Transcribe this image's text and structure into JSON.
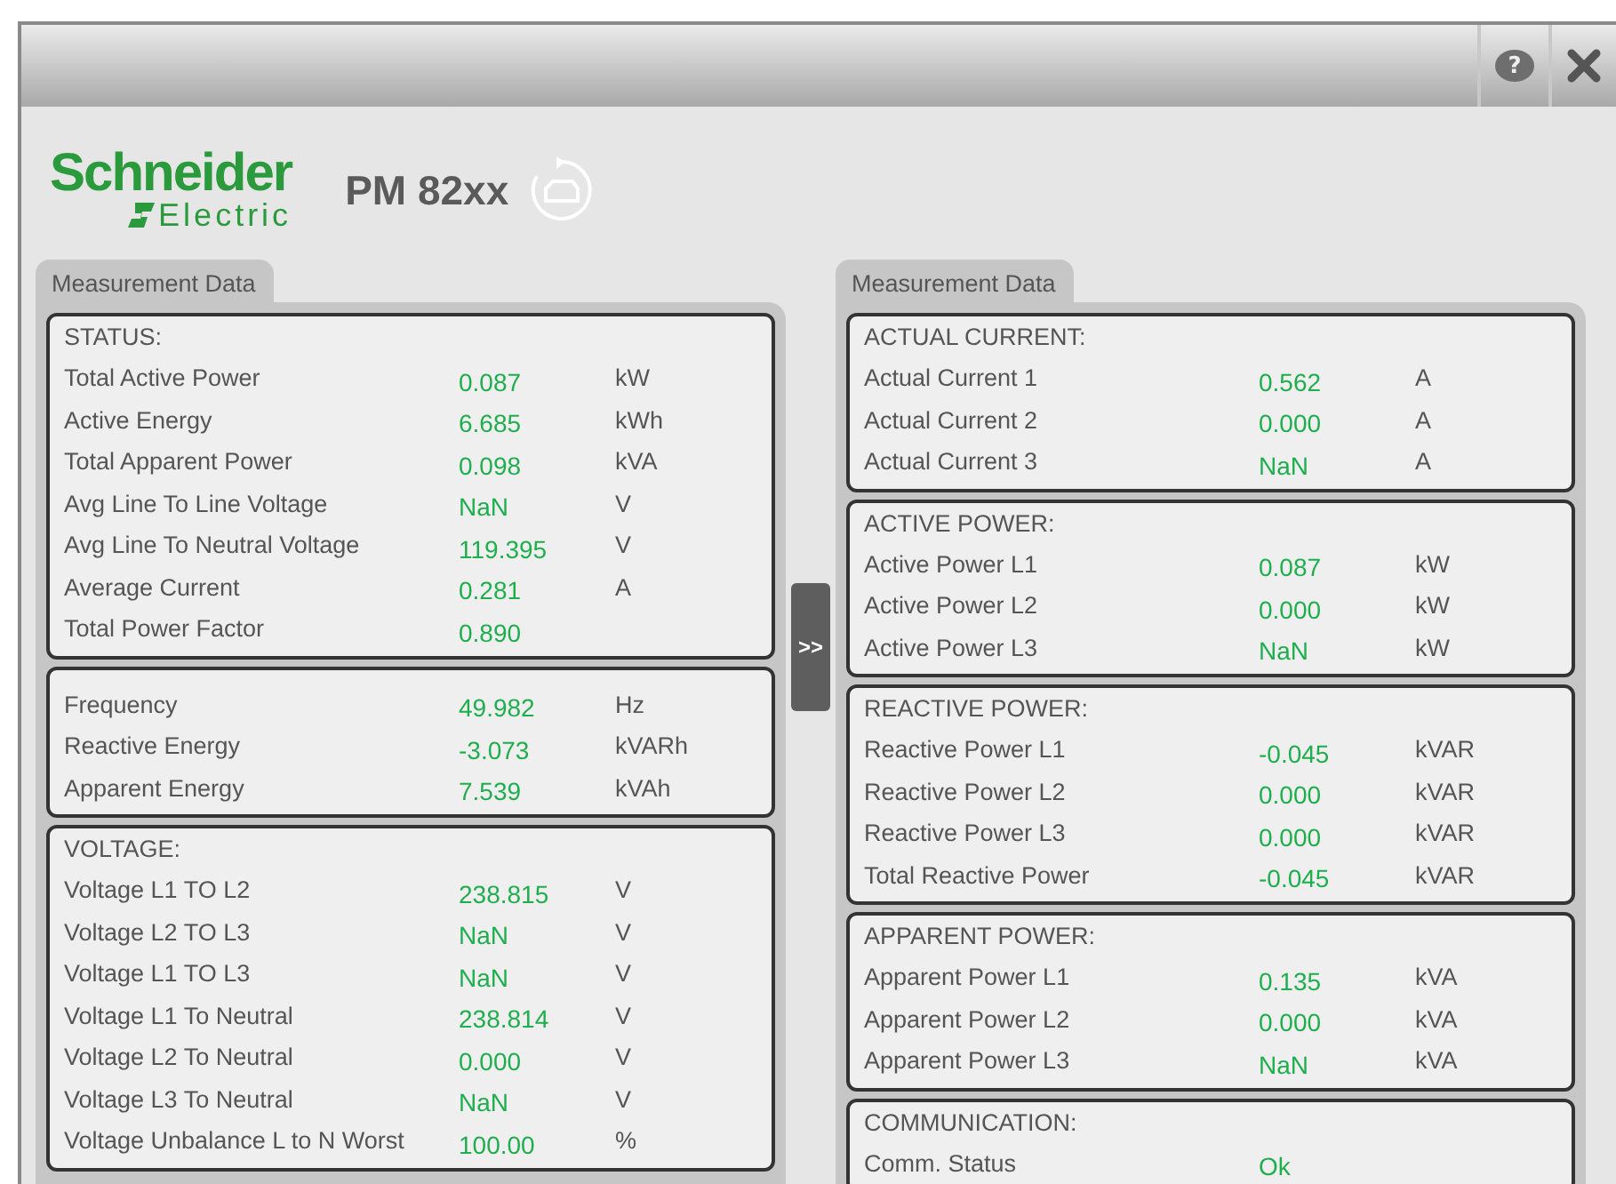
{
  "window": {
    "help_button": "?"
  },
  "header": {
    "logo": {
      "name": "Schneider",
      "sub": "Electric"
    },
    "device": "PM 82xx"
  },
  "expand_button": ">>",
  "panels": [
    {
      "tab": "Measurement Data",
      "groups": [
        {
          "title": "STATUS:",
          "rows": [
            {
              "label": "Total Active Power",
              "value": "0.087",
              "unit": "kW"
            },
            {
              "label": "Active Energy",
              "value": "6.685",
              "unit": "kWh"
            },
            {
              "label": "Total Apparent Power",
              "value": "0.098",
              "unit": "kVA"
            },
            {
              "label": "Avg Line To Line Voltage",
              "value": "NaN",
              "unit": "V"
            },
            {
              "label": "Avg Line To Neutral Voltage",
              "value": "119.395",
              "unit": "V"
            },
            {
              "label": "Average Current",
              "value": "0.281",
              "unit": "A"
            },
            {
              "label": "Total Power Factor",
              "value": "0.890"
            }
          ]
        },
        {
          "rows": [
            {
              "label": "Frequency",
              "value": "49.982",
              "unit": "Hz"
            },
            {
              "label": "Reactive Energy",
              "value": "-3.073",
              "unit": "kVARh"
            },
            {
              "label": "Apparent Energy",
              "value": "7.539",
              "unit": "kVAh"
            }
          ]
        },
        {
          "title": "VOLTAGE:",
          "rows": [
            {
              "label": "Voltage L1 TO L2",
              "value": "238.815",
              "unit": "V"
            },
            {
              "label": "Voltage L2 TO L3",
              "value": "NaN",
              "unit": "V"
            },
            {
              "label": "Voltage L1 TO L3",
              "value": "NaN",
              "unit": "V"
            },
            {
              "label": "Voltage L1 To Neutral",
              "value": "238.814",
              "unit": "V"
            },
            {
              "label": "Voltage L2 To Neutral",
              "value": "0.000",
              "unit": "V"
            },
            {
              "label": "Voltage L3 To Neutral",
              "value": "NaN",
              "unit": "V"
            },
            {
              "label": "Voltage Unbalance L to N Worst",
              "value": "100.00",
              "unit": "%"
            }
          ]
        }
      ]
    },
    {
      "tab": "Measurement Data",
      "groups": [
        {
          "title": "ACTUAL CURRENT:",
          "rows": [
            {
              "label": "Actual Current 1",
              "value": "0.562",
              "unit": "A"
            },
            {
              "label": "Actual Current 2",
              "value": "0.000",
              "unit": "A"
            },
            {
              "label": "Actual Current 3",
              "value": "NaN",
              "unit": "A"
            }
          ]
        },
        {
          "title": "ACTIVE POWER:",
          "rows": [
            {
              "label": "Active Power L1",
              "value": "0.087",
              "unit": "kW"
            },
            {
              "label": "Active Power L2",
              "value": "0.000",
              "unit": "kW"
            },
            {
              "label": "Active Power L3",
              "value": "NaN",
              "unit": "kW"
            }
          ]
        },
        {
          "title": "REACTIVE POWER:",
          "rows": [
            {
              "label": "Reactive Power L1",
              "value": "-0.045",
              "unit": "kVAR"
            },
            {
              "label": "Reactive Power L2",
              "value": "0.000",
              "unit": "kVAR"
            },
            {
              "label": "Reactive Power L3",
              "value": "0.000",
              "unit": "kVAR"
            },
            {
              "label": "Total Reactive Power",
              "value": "-0.045",
              "unit": "kVAR"
            }
          ]
        },
        {
          "title": "APPARENT POWER:",
          "rows": [
            {
              "label": "Apparent Power L1",
              "value": "0.135",
              "unit": "kVA"
            },
            {
              "label": "Apparent Power L2",
              "value": "0.000",
              "unit": "kVA"
            },
            {
              "label": "Apparent Power L3",
              "value": "NaN",
              "unit": "kVA"
            }
          ]
        },
        {
          "title": "COMMUNICATION:",
          "rows": [
            {
              "label": "Comm. Status",
              "value": "Ok"
            }
          ]
        }
      ]
    }
  ]
}
